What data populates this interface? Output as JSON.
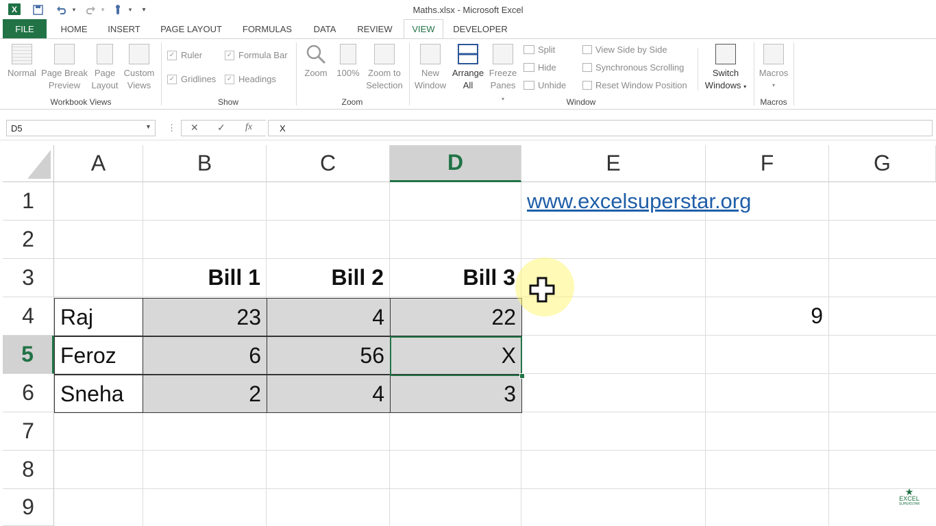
{
  "window": {
    "title": "Maths.xlsx - Microsoft Excel"
  },
  "quick_access": {
    "app_icon": "X",
    "save_icon": "save-icon",
    "undo_icon": "undo-icon",
    "redo_icon": "redo-icon",
    "touch_icon": "touch-mode-icon"
  },
  "tabs": {
    "file": "FILE",
    "home": "HOME",
    "insert": "INSERT",
    "page_layout": "PAGE LAYOUT",
    "formulas": "FORMULAS",
    "data": "DATA",
    "review": "REVIEW",
    "view": "VIEW",
    "developer": "DEVELOPER"
  },
  "ribbon": {
    "workbook_views": {
      "label": "Workbook Views",
      "normal": "Normal",
      "page_break_1": "Page Break",
      "page_break_2": "Preview",
      "page_layout_1": "Page",
      "page_layout_2": "Layout",
      "custom_1": "Custom",
      "custom_2": "Views"
    },
    "show": {
      "label": "Show",
      "ruler": "Ruler",
      "formula_bar": "Formula Bar",
      "gridlines": "Gridlines",
      "headings": "Headings"
    },
    "zoom": {
      "label": "Zoom",
      "zoom": "Zoom",
      "hundred": "100%",
      "sel_1": "Zoom to",
      "sel_2": "Selection"
    },
    "window": {
      "label": "Window",
      "new_1": "New",
      "new_2": "Window",
      "arrange_1": "Arrange",
      "arrange_2": "All",
      "freeze_1": "Freeze",
      "freeze_2": "Panes",
      "split": "Split",
      "hide": "Hide",
      "unhide": "Unhide",
      "side_by_side": "View Side by Side",
      "sync_scroll": "Synchronous Scrolling",
      "reset_pos": "Reset Window Position",
      "switch_1": "Switch",
      "switch_2": "Windows"
    },
    "macros": {
      "label": "Macros",
      "macros": "Macros"
    }
  },
  "formula_bar": {
    "name_box": "D5",
    "formula": "X",
    "cancel": "✕",
    "enter": "✓",
    "fx": "fx"
  },
  "columns": [
    "A",
    "B",
    "C",
    "D",
    "E",
    "F",
    "G"
  ],
  "rows": [
    "1",
    "2",
    "3",
    "4",
    "5",
    "6",
    "7",
    "8",
    "9"
  ],
  "cells": {
    "E1": "www.excelsuperstar.org",
    "B3": "Bill 1",
    "C3": "Bill 2",
    "D3": "Bill 3",
    "A4": "Raj",
    "B4": "23",
    "C4": "4",
    "D4": "22",
    "F4": "9",
    "A5": "Feroz",
    "B5": "6",
    "C5": "56",
    "D5": "X",
    "A6": "Sneha",
    "B6": "2",
    "C6": "4",
    "D6": "3"
  },
  "selection": {
    "active_cell": "D5"
  },
  "watermark": {
    "line1": "EXCEL",
    "line2": "SUPERSTAR"
  }
}
